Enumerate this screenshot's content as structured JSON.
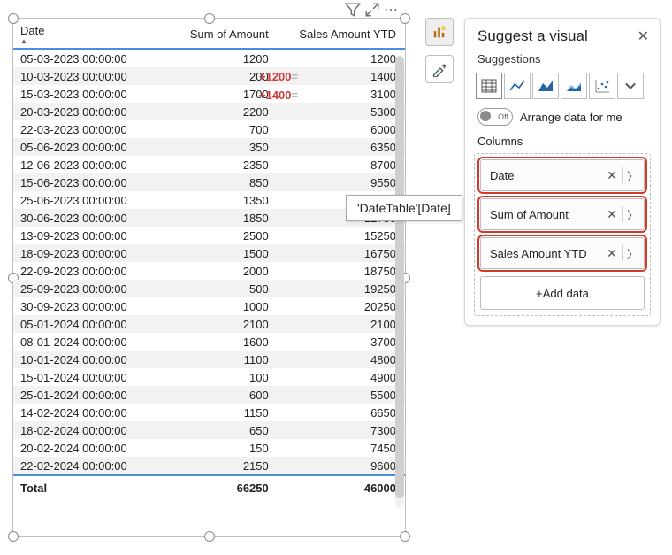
{
  "table": {
    "headers": [
      "Date",
      "Sum of Amount",
      "Sales Amount YTD"
    ],
    "rows": [
      {
        "date": "05-03-2023 00:00:00",
        "amount": "1200",
        "ytd": "1200"
      },
      {
        "date": "10-03-2023 00:00:00",
        "amount": "200",
        "ytd": "1400"
      },
      {
        "date": "15-03-2023 00:00:00",
        "amount": "1700",
        "ytd": "3100"
      },
      {
        "date": "20-03-2023 00:00:00",
        "amount": "2200",
        "ytd": "5300"
      },
      {
        "date": "22-03-2023 00:00:00",
        "amount": "700",
        "ytd": "6000"
      },
      {
        "date": "05-06-2023 00:00:00",
        "amount": "350",
        "ytd": "6350"
      },
      {
        "date": "12-06-2023 00:00:00",
        "amount": "2350",
        "ytd": "8700"
      },
      {
        "date": "15-06-2023 00:00:00",
        "amount": "850",
        "ytd": "9550"
      },
      {
        "date": "25-06-2023 00:00:00",
        "amount": "1350",
        "ytd": "10900"
      },
      {
        "date": "30-06-2023 00:00:00",
        "amount": "1850",
        "ytd": "12750"
      },
      {
        "date": "13-09-2023 00:00:00",
        "amount": "2500",
        "ytd": "15250"
      },
      {
        "date": "18-09-2023 00:00:00",
        "amount": "1500",
        "ytd": "16750"
      },
      {
        "date": "22-09-2023 00:00:00",
        "amount": "2000",
        "ytd": "18750"
      },
      {
        "date": "25-09-2023 00:00:00",
        "amount": "500",
        "ytd": "19250"
      },
      {
        "date": "30-09-2023 00:00:00",
        "amount": "1000",
        "ytd": "20250"
      },
      {
        "date": "05-01-2024 00:00:00",
        "amount": "2100",
        "ytd": "2100"
      },
      {
        "date": "08-01-2024 00:00:00",
        "amount": "1600",
        "ytd": "3700"
      },
      {
        "date": "10-01-2024 00:00:00",
        "amount": "1100",
        "ytd": "4800"
      },
      {
        "date": "15-01-2024 00:00:00",
        "amount": "100",
        "ytd": "4900"
      },
      {
        "date": "25-01-2024 00:00:00",
        "amount": "600",
        "ytd": "5500"
      },
      {
        "date": "14-02-2024 00:00:00",
        "amount": "1150",
        "ytd": "6650"
      },
      {
        "date": "18-02-2024 00:00:00",
        "amount": "650",
        "ytd": "7300"
      },
      {
        "date": "20-02-2024 00:00:00",
        "amount": "150",
        "ytd": "7450"
      },
      {
        "date": "22-02-2024 00:00:00",
        "amount": "2150",
        "ytd": "9600"
      }
    ],
    "total": {
      "label": "Total",
      "amount": "66250",
      "ytd": "46000"
    }
  },
  "annotations": {
    "row1": "+1200=",
    "row2": "+1400="
  },
  "tooltip": "'DateTable'[Date]",
  "toolbar": {
    "filter": "▽",
    "focus": "⤢",
    "more": "⋯"
  },
  "panel": {
    "title": "Suggest a visual",
    "close": "✕",
    "suggestions_label": "Suggestions",
    "arrange_label": "Arrange data for me",
    "toggle_text": "Off",
    "columns_label": "Columns",
    "fields": [
      {
        "name": "Date"
      },
      {
        "name": "Sum of Amount"
      },
      {
        "name": "Sales Amount YTD"
      }
    ],
    "add_data": "+Add data"
  }
}
